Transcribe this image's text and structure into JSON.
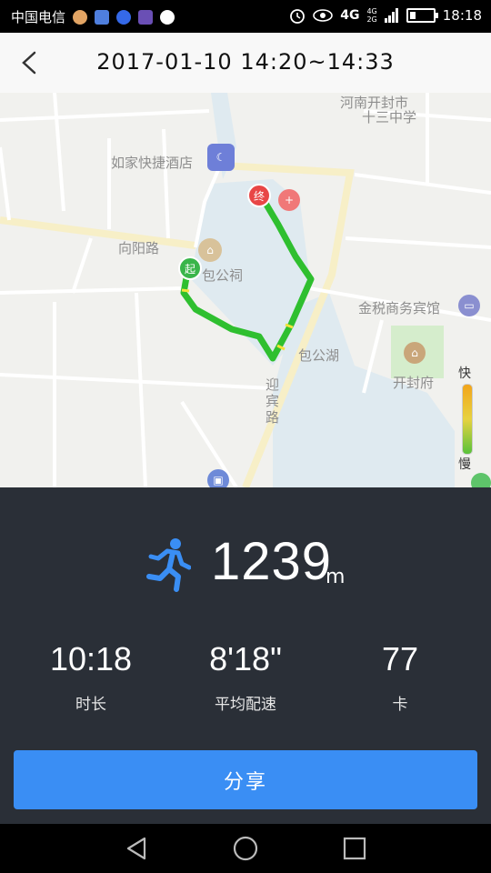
{
  "status_bar": {
    "carrier": "中国电信",
    "network_top": "4G",
    "network_bottom": "2G",
    "network_label": "4G",
    "time": "18:18"
  },
  "header": {
    "title": "2017-01-10 14:20~14:33"
  },
  "map": {
    "labels": {
      "hotel": "如家快捷酒店",
      "school_line1": "河南开封市",
      "school_line2": "十三中学",
      "xiangyang_road": "向阳路",
      "bao_temple": "包公祠",
      "bao_lake": "包公湖",
      "jinshui_hotel": "金税商务宾馆",
      "kaifeng_fu": "开封府",
      "yingbin_road": "迎宾路"
    },
    "markers": {
      "start": "起",
      "end": "终"
    },
    "legend": {
      "fast": "快",
      "slow": "慢"
    }
  },
  "summary": {
    "distance": "1239",
    "distance_unit": "m",
    "duration": "10:18",
    "duration_label": "时长",
    "pace": "8'18\"",
    "pace_label": "平均配速",
    "calories": "77",
    "calories_label": "卡"
  },
  "share_button": {
    "label": "分享"
  },
  "icons": {
    "back": "chevron-left-icon",
    "runner": "running-person-icon",
    "nav_back": "triangle-back-icon",
    "nav_home": "circle-home-icon",
    "nav_recent": "square-recent-icon"
  },
  "colors": {
    "accent": "#3a8ef4",
    "route": "#2fbf2f",
    "panel_bg": "#2a2f37"
  }
}
